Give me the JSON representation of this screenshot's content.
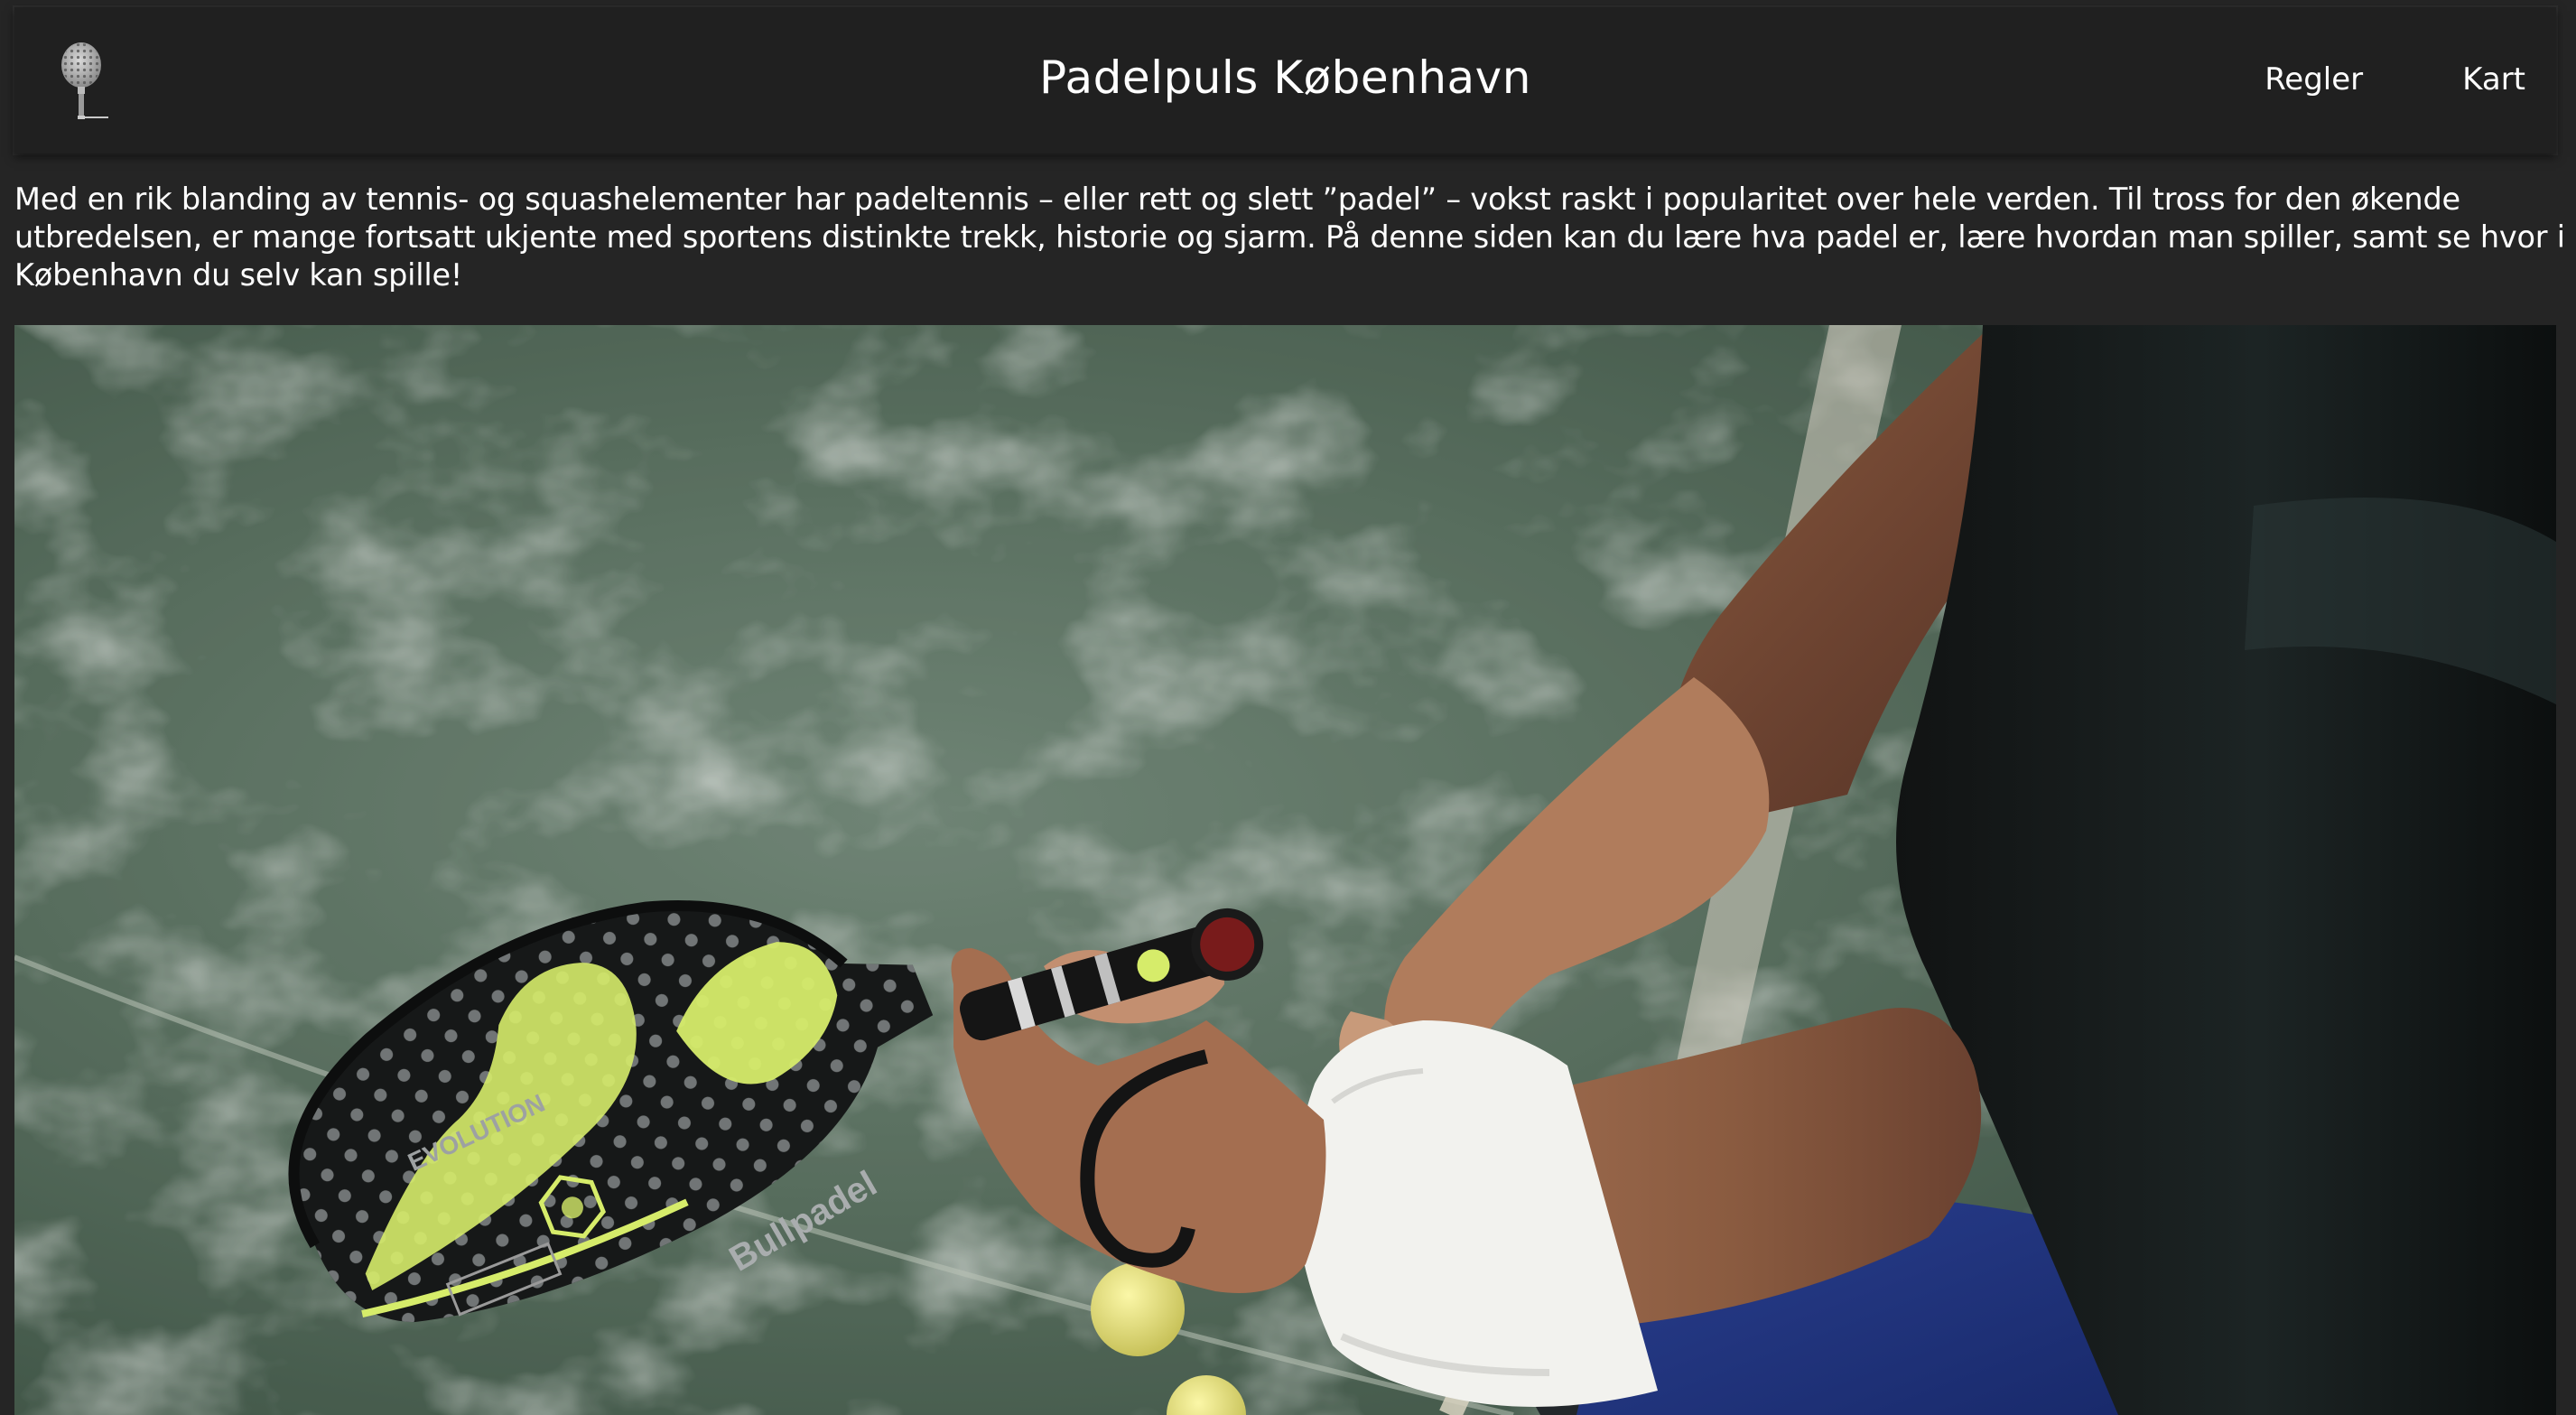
{
  "header": {
    "title": "Padelpuls København",
    "logo_icon": "padel-racket-icon",
    "nav": [
      {
        "label": "Regler"
      },
      {
        "label": "Kart"
      }
    ]
  },
  "intro": {
    "text": "Med en rik blanding av tennis- og squashelementer har padeltennis – eller rett og slett ”padel” – vokst raskt i popularitet over hele verden. Til tross for den økende utbredelsen, er mange fortsatt ukjente med sportens distinkte trekk, historie og sjarm. På denne siden kan du lære hva padel er, lære hvordan man spiller, samt se hvor i København du selv kan spille!"
  },
  "hero": {
    "racket_brand": "Bullpadel",
    "racket_model": "EVOLUTION"
  },
  "colors": {
    "page_background": "#252525",
    "header_background": "#202020",
    "text": "#ffffff",
    "court_green": "#5d7563",
    "racket_accent": "#d6ec6a"
  }
}
